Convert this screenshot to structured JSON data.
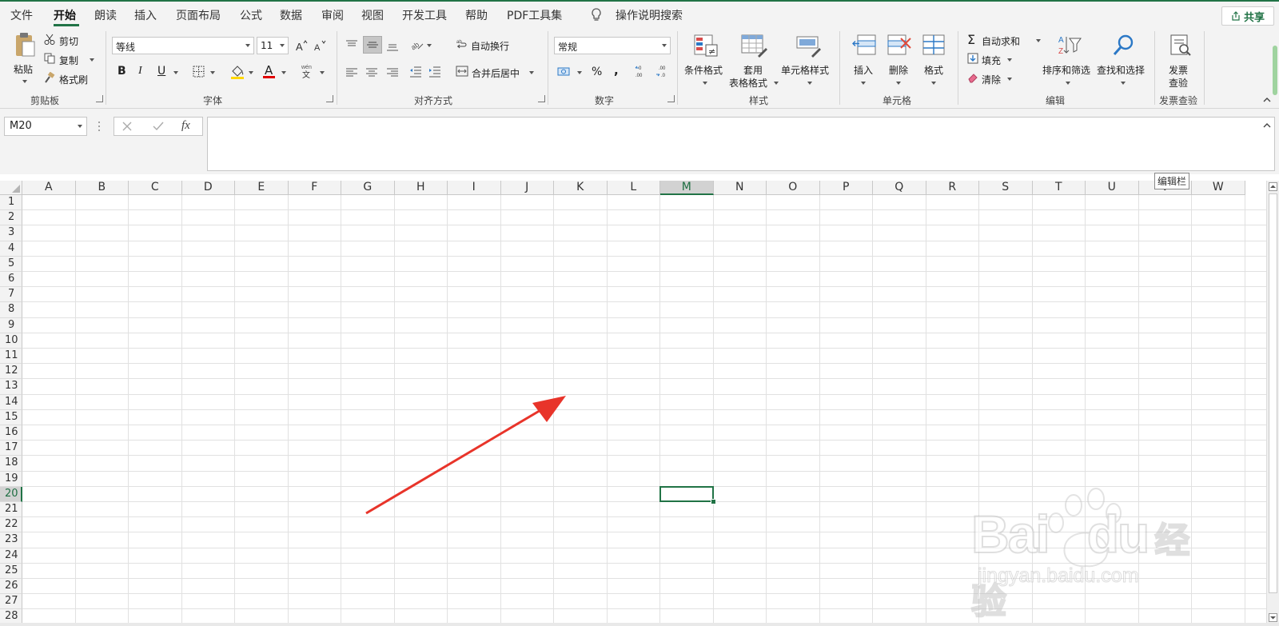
{
  "menu": {
    "items": [
      "文件",
      "开始",
      "朗读",
      "插入",
      "页面布局",
      "公式",
      "数据",
      "审阅",
      "视图",
      "开发工具",
      "帮助",
      "PDF工具集"
    ],
    "active_index": 1,
    "search_label": "操作说明搜索",
    "share_label": "共享"
  },
  "ribbon": {
    "clipboard": {
      "paste": "粘贴",
      "cut": "剪切",
      "copy": "复制",
      "format_painter": "格式刷",
      "label": "剪贴板"
    },
    "font": {
      "font_name": "等线",
      "font_size": "11",
      "bold": "B",
      "italic": "I",
      "underline": "U",
      "font_color_letter": "A",
      "label": "字体"
    },
    "alignment": {
      "wrap_text": "自动换行",
      "merge_center": "合并后居中",
      "label": "对齐方式"
    },
    "number": {
      "format": "常规",
      "percent": "%",
      "comma": ",",
      "label": "数字"
    },
    "styles": {
      "conditional": "条件格式",
      "table_line1": "套用",
      "table_line2": "表格格式",
      "cell_styles": "单元格样式",
      "label": "样式"
    },
    "cells": {
      "insert": "插入",
      "delete": "删除",
      "format": "格式",
      "label": "单元格"
    },
    "editing": {
      "autosum": "自动求和",
      "fill": "填充",
      "clear": "清除",
      "sort_filter": "排序和筛选",
      "find_select": "查找和选择",
      "label": "编辑"
    },
    "invoice": {
      "line1": "发票",
      "line2": "查验",
      "label": "发票查验"
    }
  },
  "formula_bar": {
    "name_box": "M20",
    "fx": "fx",
    "value": "",
    "tooltip": "编辑栏"
  },
  "grid": {
    "columns": [
      "A",
      "B",
      "C",
      "D",
      "E",
      "F",
      "G",
      "H",
      "I",
      "J",
      "K",
      "L",
      "M",
      "N",
      "O",
      "P",
      "Q",
      "R",
      "S",
      "T",
      "U",
      "V",
      "W"
    ],
    "rows": [
      "1",
      "2",
      "3",
      "4",
      "5",
      "6",
      "7",
      "8",
      "9",
      "10",
      "11",
      "12",
      "13",
      "14",
      "15",
      "16",
      "17",
      "18",
      "19",
      "20",
      "21",
      "22",
      "23",
      "24",
      "25",
      "26",
      "27",
      "28"
    ],
    "selected_column": "M",
    "selected_row": "20"
  },
  "colors": {
    "accent": "#217346",
    "arrow": "#e8342a"
  },
  "watermark": {
    "brand": "Bai",
    "brand2": "du",
    "cn": "经验",
    "url": "jingyan.baidu.com"
  }
}
